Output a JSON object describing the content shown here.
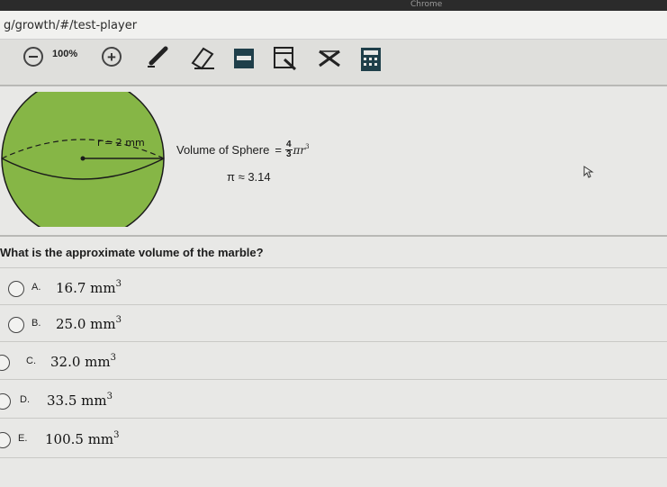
{
  "browser": {
    "app_label": "Chrome",
    "url": "g/growth/#/test-player"
  },
  "toolbar": {
    "zoom_level": "100%",
    "zoom_in_label": "+",
    "tools": [
      "pencil-icon",
      "eraser-icon",
      "highlighter-icon",
      "line-reader-icon",
      "answer-eliminator-icon",
      "calculator-icon"
    ]
  },
  "figure": {
    "radius_label": "r = 2 mm",
    "sphere_color": "#86b646"
  },
  "formula": {
    "label": "Volume of Sphere",
    "equals": "=",
    "numerator": "4",
    "denominator": "3",
    "pi_r": "πr",
    "exponent": "3",
    "pi_approx": "π ≈ 3.14"
  },
  "question": {
    "text": "What is the approximate volume of the marble?"
  },
  "options": [
    {
      "letter": "A.",
      "value": "16.7 mm",
      "exp": "3"
    },
    {
      "letter": "B.",
      "value": "25.0 mm",
      "exp": "3"
    },
    {
      "letter": "C.",
      "value": "32.0 mm",
      "exp": "3"
    },
    {
      "letter": "D.",
      "value": "33.5 mm",
      "exp": "3"
    },
    {
      "letter": "E.",
      "value": "100.5 mm",
      "exp": "3"
    }
  ]
}
